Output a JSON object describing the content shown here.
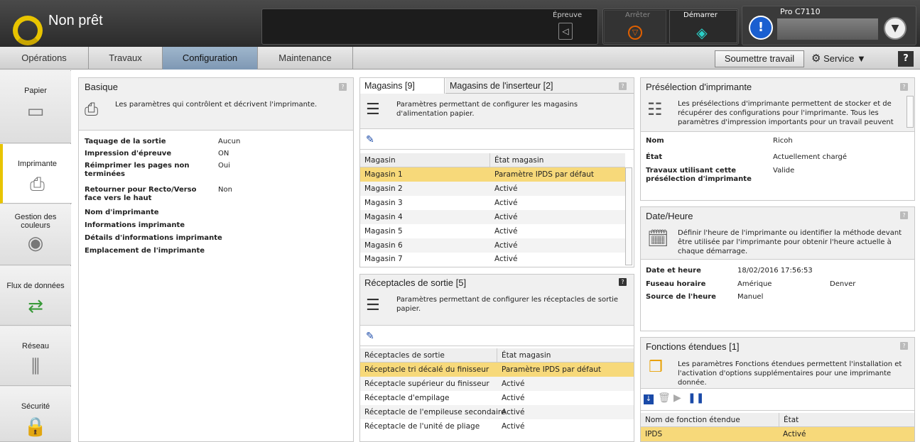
{
  "header": {
    "status": "Non prêt",
    "proof_label": "Épreuve",
    "stop_label": "Arrêter",
    "start_label": "Démarrer",
    "model": "Pro C7110",
    "alert_symbol": "!"
  },
  "tabs": [
    {
      "label": "Opérations"
    },
    {
      "label": "Travaux"
    },
    {
      "label": "Configuration"
    },
    {
      "label": "Maintenance"
    }
  ],
  "toolbar": {
    "submit": "Soumettre travail",
    "service": "Service ▼",
    "help": "?"
  },
  "nav": [
    {
      "label": "Papier"
    },
    {
      "label": "Imprimante"
    },
    {
      "label": "Gestion des couleurs"
    },
    {
      "label": "Flux de données"
    },
    {
      "label": "Réseau"
    },
    {
      "label": "Sécurité"
    }
  ],
  "basique": {
    "title": "Basique",
    "desc": "Les paramètres qui contrôlent et décrivent l'imprimante.",
    "rows": [
      {
        "label": "Taquage de la sortie",
        "value": "Aucun"
      },
      {
        "label": "Impression d'épreuve",
        "value": "ON"
      },
      {
        "label": "Réimprimer les pages non terminées",
        "value": "Oui"
      },
      {
        "label": "Retourner pour Recto/Verso face vers le haut",
        "value": "Non"
      },
      {
        "label": "Nom d'imprimante",
        "value": ""
      },
      {
        "label": "Informations imprimante",
        "value": ""
      },
      {
        "label": "Détails d'informations imprimante",
        "value": ""
      },
      {
        "label": "Emplacement de l'imprimante",
        "value": ""
      }
    ]
  },
  "magasins": {
    "tab1": "Magasins [9]",
    "tab2": "Magasins de l'inserteur [2]",
    "desc": "Paramètres permettant de configurer les magasins d'alimentation papier.",
    "col1": "Magasin",
    "col2": "État magasin",
    "rows": [
      {
        "name": "Magasin 1",
        "state": "Paramètre IPDS par défaut"
      },
      {
        "name": "Magasin 2",
        "state": "Activé"
      },
      {
        "name": "Magasin 3",
        "state": "Activé"
      },
      {
        "name": "Magasin 4",
        "state": "Activé"
      },
      {
        "name": "Magasin 5",
        "state": "Activé"
      },
      {
        "name": "Magasin 6",
        "state": "Activé"
      },
      {
        "name": "Magasin 7",
        "state": "Activé"
      }
    ]
  },
  "receptacles": {
    "title": "Réceptacles de sortie [5]",
    "desc": "Paramètres permettant de configurer les réceptacles de sortie papier.",
    "col1": "Réceptacles de sortie",
    "col2": "État magasin",
    "rows": [
      {
        "name": "Réceptacle tri décalé du finisseur",
        "state": "Paramètre IPDS par défaut"
      },
      {
        "name": "Réceptacle supérieur du finisseur",
        "state": "Activé"
      },
      {
        "name": "Réceptacle d'empilage",
        "state": "Activé"
      },
      {
        "name": "Réceptacle de l'empileuse secondaire",
        "state": "Activé"
      },
      {
        "name": "Réceptacle de l'unité de pliage",
        "state": "Activé"
      }
    ]
  },
  "preselection": {
    "title": "Présélection d'imprimante",
    "desc": "Les présélections d'imprimante permettent de stocker et de récupérer des configurations pour l'imprimante. Tous les paramètres d'impression importants pour un travail peuvent être",
    "rows": [
      {
        "label": "Nom",
        "value": "Ricoh"
      },
      {
        "label": "État",
        "value": "Actuellement chargé"
      },
      {
        "label": "Travaux utilisant cette présélection d'imprimante",
        "value": "Valide"
      }
    ]
  },
  "datetime": {
    "title": "Date/Heure",
    "desc": "Définir l'heure de l'imprimante ou identifier la méthode devant être utilisée par l'imprimante pour obtenir l'heure actuelle à chaque démarrage.",
    "rows": [
      {
        "label": "Date et heure",
        "value": "18/02/2016 17:56:53",
        "extra": ""
      },
      {
        "label": "Fuseau horaire",
        "value": "Amérique",
        "extra": "Denver"
      },
      {
        "label": "Source de l'heure",
        "value": "Manuel",
        "extra": ""
      }
    ]
  },
  "fonctions": {
    "title": "Fonctions étendues [1]",
    "desc": "Les paramètres Fonctions étendues permettent l'installation et l'activation d'options supplémentaires pour une imprimante donnée.",
    "col1": "Nom de fonction étendue",
    "col2": "État",
    "rows": [
      {
        "name": "IPDS",
        "state": "Activé"
      }
    ]
  }
}
